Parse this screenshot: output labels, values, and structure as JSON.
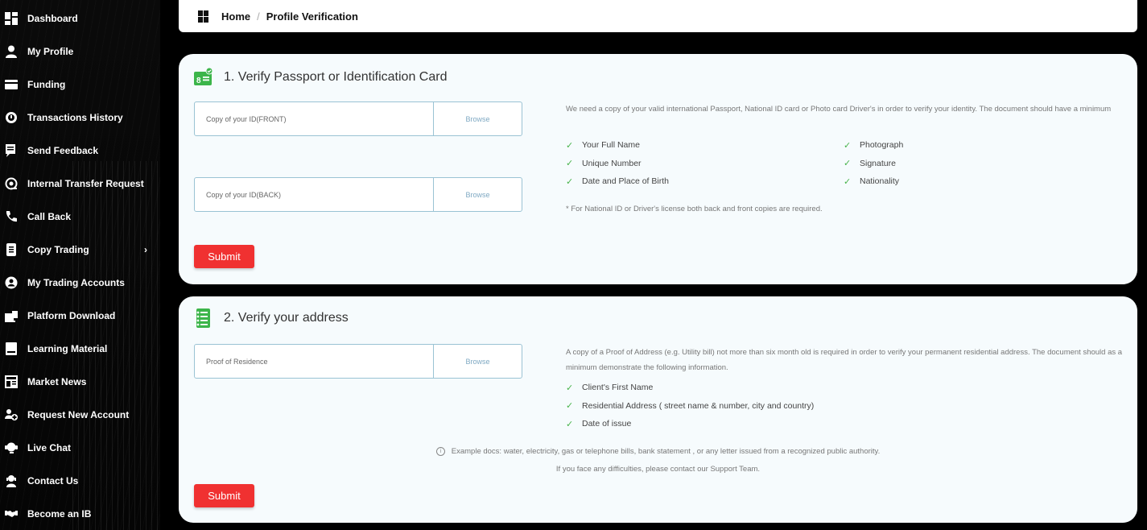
{
  "sidebar": {
    "items": [
      {
        "label": "Dashboard",
        "icon": "dashboard-icon"
      },
      {
        "label": "My Profile",
        "icon": "user-icon"
      },
      {
        "label": "Funding",
        "icon": "card-icon"
      },
      {
        "label": "Transactions History",
        "icon": "history-icon"
      },
      {
        "label": "Send Feedback",
        "icon": "feedback-icon"
      },
      {
        "label": "Internal Transfer Request",
        "icon": "transfer-icon"
      },
      {
        "label": "Call Back",
        "icon": "phone-icon"
      },
      {
        "label": "Copy Trading",
        "icon": "copy-icon",
        "chevron": "›"
      },
      {
        "label": "My Trading Accounts",
        "icon": "account-icon"
      },
      {
        "label": "Platform Download",
        "icon": "download-icon"
      },
      {
        "label": "Learning Material",
        "icon": "book-icon"
      },
      {
        "label": "Market News",
        "icon": "news-icon"
      },
      {
        "label": "Request New Account",
        "icon": "new-account-icon"
      },
      {
        "label": "Live Chat",
        "icon": "chat-icon"
      },
      {
        "label": "Contact Us",
        "icon": "contact-icon"
      },
      {
        "label": "Become an IB",
        "icon": "handshake-icon"
      }
    ]
  },
  "breadcrumb": {
    "home": "Home",
    "separator": "/",
    "current": "Profile Verification"
  },
  "section1": {
    "title": "1. Verify Passport or Identification Card",
    "front_placeholder": "Copy of your ID(FRONT)",
    "back_placeholder": "Copy of your ID(BACK)",
    "browse_label": "Browse",
    "description": "We need a copy of your valid international Passport, National ID card or Photo card Driver's in order to verify your identity. The document should have a minimum",
    "requirements_left": [
      "Your Full Name",
      "Unique Number",
      "Date and Place of Birth"
    ],
    "requirements_right": [
      "Photograph",
      "Signature",
      "Nationality"
    ],
    "note": "* For National ID or Driver's license both back and front copies are required.",
    "submit_label": "Submit"
  },
  "section2": {
    "title": "2. Verify your address",
    "residence_placeholder": "Proof of Residence",
    "browse_label": "Browse",
    "description": "A copy of a Proof of Address (e.g. Utility bill) not more than six month old is required in order to verify your permanent residential address. The document should as a minimum demonstrate the following information.",
    "requirements": [
      "Client's First Name",
      "Residential Address ( street name & number, city and country)",
      "Date of issue"
    ],
    "example_note": "Example docs: water, electricity, gas or telephone bills, bank statement , or any letter issued from a recognized public authority.",
    "support_note": "If you face any difficulties, please contact our Support Team.",
    "submit_label": "Submit"
  },
  "colors": {
    "accent_red": "#f03131",
    "check_green": "#48b34a",
    "card_bg": "#f6fbfd"
  }
}
